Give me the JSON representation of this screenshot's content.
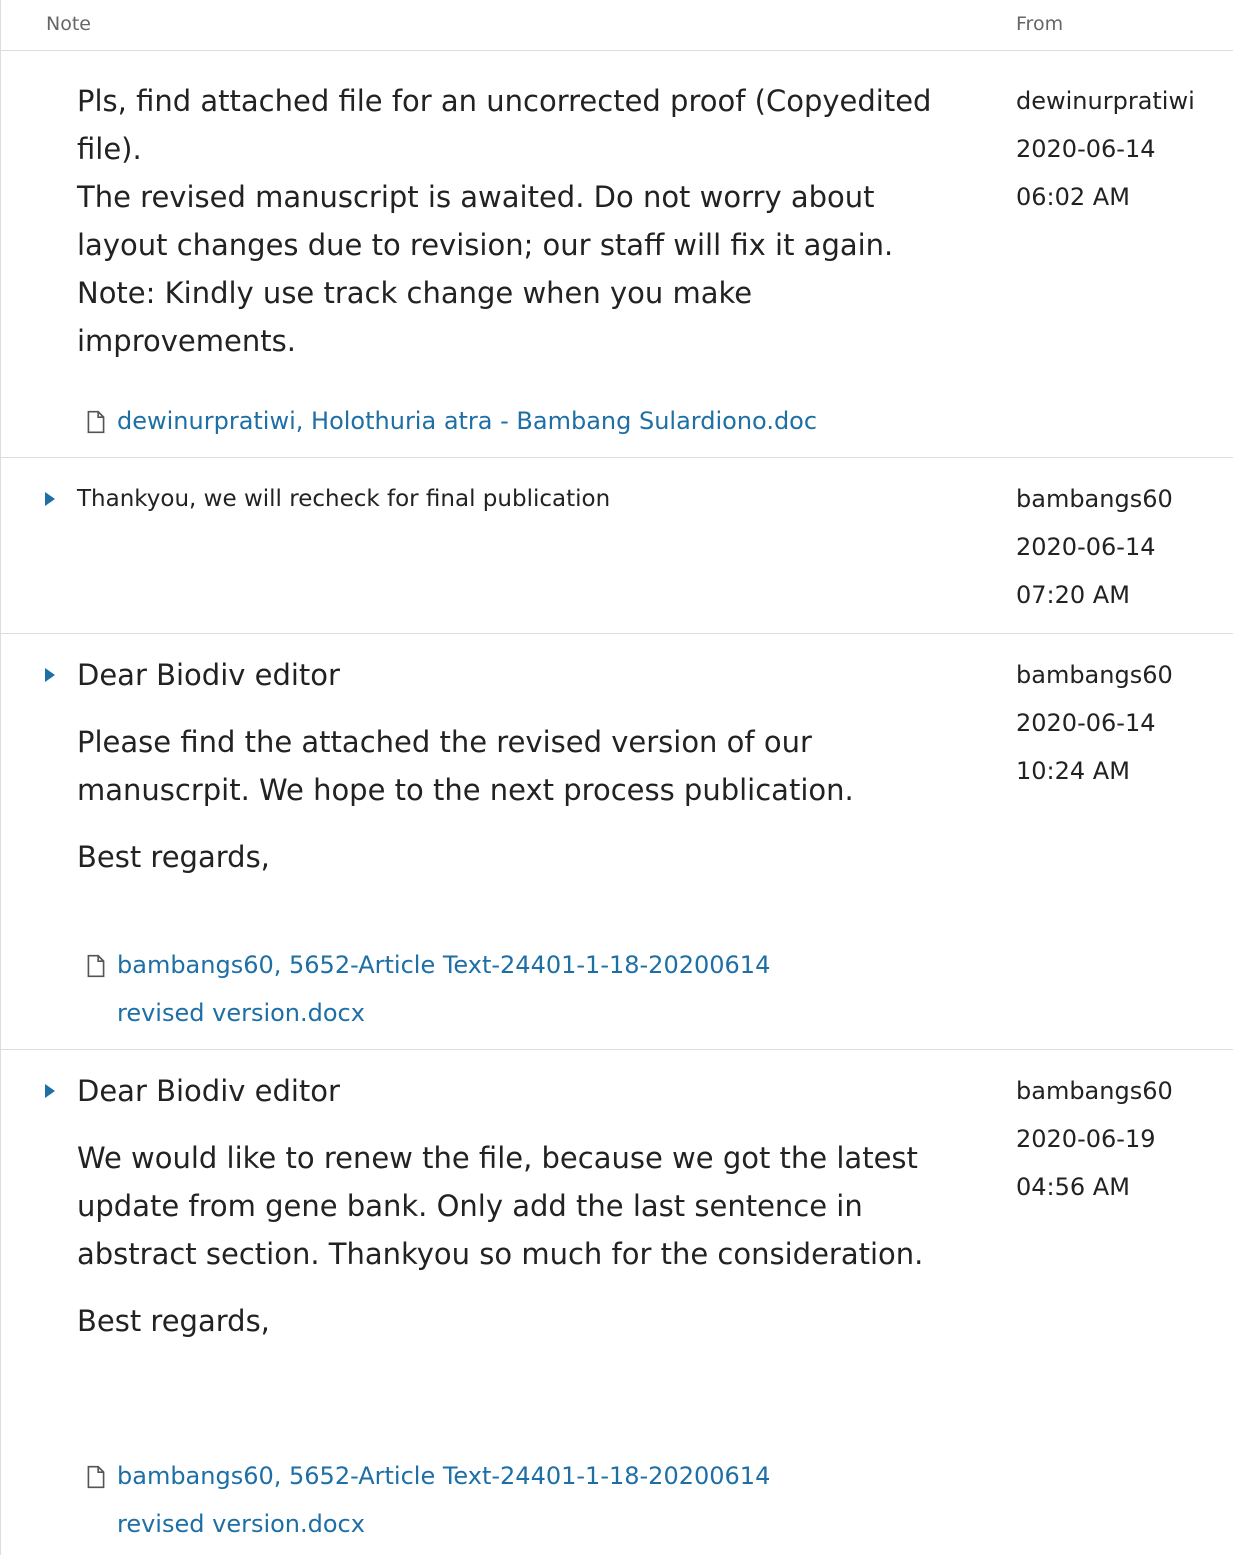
{
  "table": {
    "header": {
      "note": "Note",
      "from": "From"
    },
    "rows": [
      {
        "paragraphs": [
          "Pls, find attached file for an uncorrected proof (Copyedited file).",
          "The revised manuscript is awaited. Do not worry about layout changes due to revision; our staff will fix it again.",
          "Note: Kindly use track change when you make improvements."
        ],
        "attachment": "dewinurpratiwi, Holothuria atra - Bambang Sulardiono.doc",
        "author": "dewinurpratiwi",
        "date": "2020-06-14",
        "time": "06:02 AM"
      },
      {
        "paragraphs": [
          "Thankyou, we will recheck for final publication"
        ],
        "author": "bambangs60",
        "date": "2020-06-14",
        "time": "07:20 AM"
      },
      {
        "paragraphs": [
          "Dear Biodiv editor",
          "Please find the attached the revised version of our manuscrpit. We hope to the next process publication.",
          "Best regards,"
        ],
        "attachment": "bambangs60, 5652-Article Text-24401-1-18-20200614 revised version.docx",
        "author": "bambangs60",
        "date": "2020-06-14",
        "time": "10:24 AM"
      },
      {
        "paragraphs": [
          "Dear Biodiv editor",
          "We would like to renew the file, because we got the latest update from gene bank. Only add the last sentence in abstract section. Thankyou so much for the consideration.",
          "Best regards,"
        ],
        "attachment": "bambangs60, 5652-Article Text-24401-1-18-20200614 revised version.docx",
        "author": "bambangs60",
        "date": "2020-06-19",
        "time": "04:56 AM"
      }
    ]
  },
  "colors": {
    "link": "#1e6fa5",
    "border": "#dddddd",
    "text": "#222222",
    "muted": "#666666"
  },
  "icons": {
    "toggle": "triangle-right-icon",
    "file": "document-icon"
  }
}
